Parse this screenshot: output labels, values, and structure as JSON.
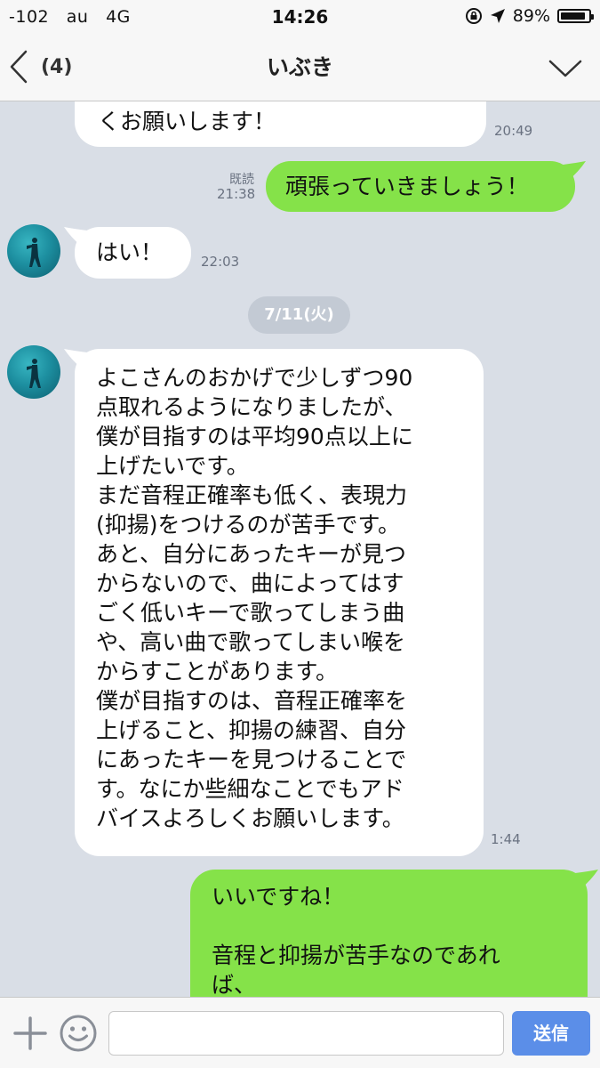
{
  "status_bar": {
    "signal": "-102",
    "carrier": "au",
    "network": "4G",
    "time": "14:26",
    "battery": "89%",
    "battery_level": 0.89
  },
  "nav": {
    "back_count": "(4)",
    "title": "いぶき"
  },
  "messages": [
    {
      "side": "in",
      "text": "くお願いします！",
      "time": "20:49"
    },
    {
      "side": "out",
      "text": "頑張っていきましょう！",
      "read": "既読",
      "time": "21:38"
    },
    {
      "side": "in",
      "text": "はい！",
      "time": "22:03"
    },
    {
      "side": "in",
      "text": "よこさんのおかげで少しずつ90\n点取れるようになりましたが、\n僕が目指すのは平均90点以上に\n上げたいです。\nまだ音程正確率も低く、表現力\n(抑揚)をつけるのが苦手です。\nあと、自分にあったキーが見つ\nからないので、曲によってはす\nごく低いキーで歌ってしまう曲\nや、高い曲で歌ってしまい喉を\nからすことがあります。\n僕が目指すのは、音程正確率を\n上げること、抑揚の練習、自分\nにあったキーを見つけることで\nす。なにか些細なことでもアド\nバイスよろしくお願いします。",
      "time": "1:44"
    },
    {
      "side": "out",
      "text": "いいですね！\n\n音程と抑揚が苦手なのであれ\nば、"
    }
  ],
  "date_separator": "7/11(火)",
  "input": {
    "placeholder": "",
    "send_label": "送信"
  },
  "colors": {
    "chat_background": "#d9dee6",
    "outgoing_bubble": "#85e249",
    "incoming_bubble": "#ffffff",
    "send_button": "#5b8ee8"
  }
}
